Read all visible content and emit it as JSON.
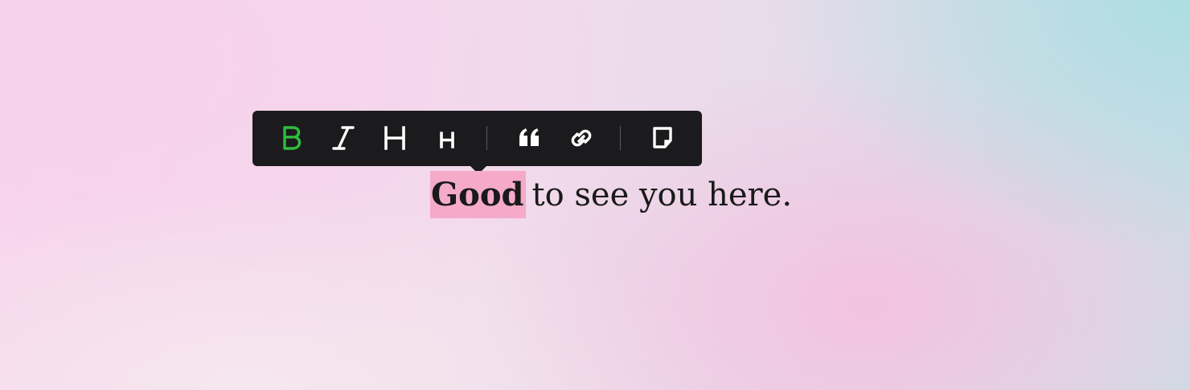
{
  "toolbar": {
    "buttons": [
      {
        "name": "bold",
        "icon": "bold-icon",
        "active": true
      },
      {
        "name": "italic",
        "icon": "italic-icon",
        "active": false
      },
      {
        "name": "heading-large",
        "icon": "heading-large-icon",
        "active": false
      },
      {
        "name": "heading-small",
        "icon": "heading-small-icon",
        "active": false
      },
      {
        "name": "quote",
        "icon": "quote-icon",
        "active": false
      },
      {
        "name": "link",
        "icon": "link-icon",
        "active": false
      },
      {
        "name": "note",
        "icon": "note-icon",
        "active": false
      }
    ],
    "background_color": "#1b1b1d",
    "active_color": "#2ebd3e",
    "icon_color": "#ffffff"
  },
  "editor": {
    "selected_text": "Good",
    "rest_text": "to see you here.",
    "highlight_color": "#f5aac9"
  }
}
